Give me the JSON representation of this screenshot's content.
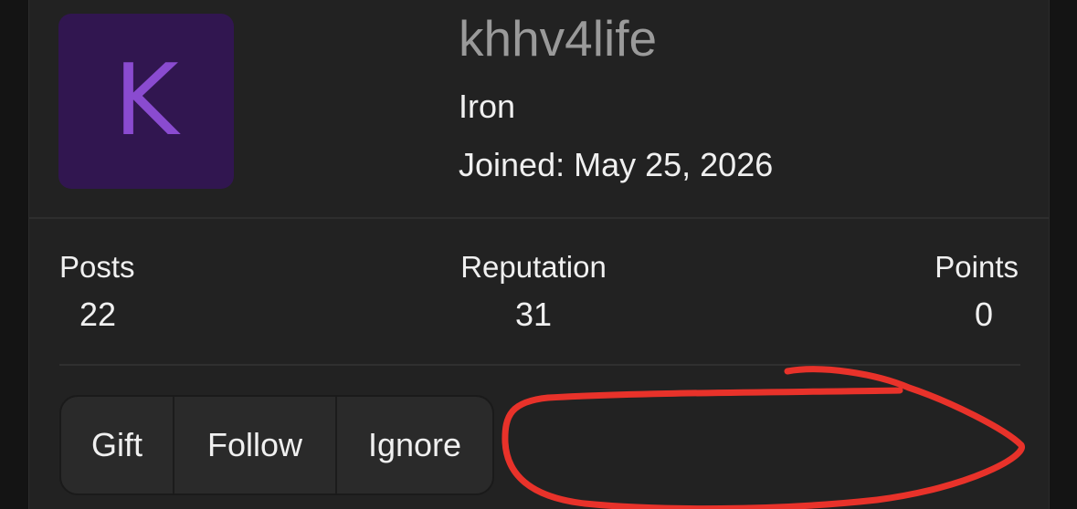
{
  "profile": {
    "avatar_letter": "K",
    "avatar_bg": "#311650",
    "avatar_fg": "#8a4bd0",
    "username": "khhv4life",
    "rank": "Iron",
    "joined": "Joined: May 25, 2026"
  },
  "stats": {
    "posts": {
      "label": "Posts",
      "value": "22"
    },
    "reputation": {
      "label": "Reputation",
      "value": "31"
    },
    "points": {
      "label": "Points",
      "value": "0"
    }
  },
  "actions": {
    "gift": "Gift",
    "follow": "Follow",
    "ignore": "Ignore"
  },
  "annotation": {
    "color": "#e8322a"
  }
}
